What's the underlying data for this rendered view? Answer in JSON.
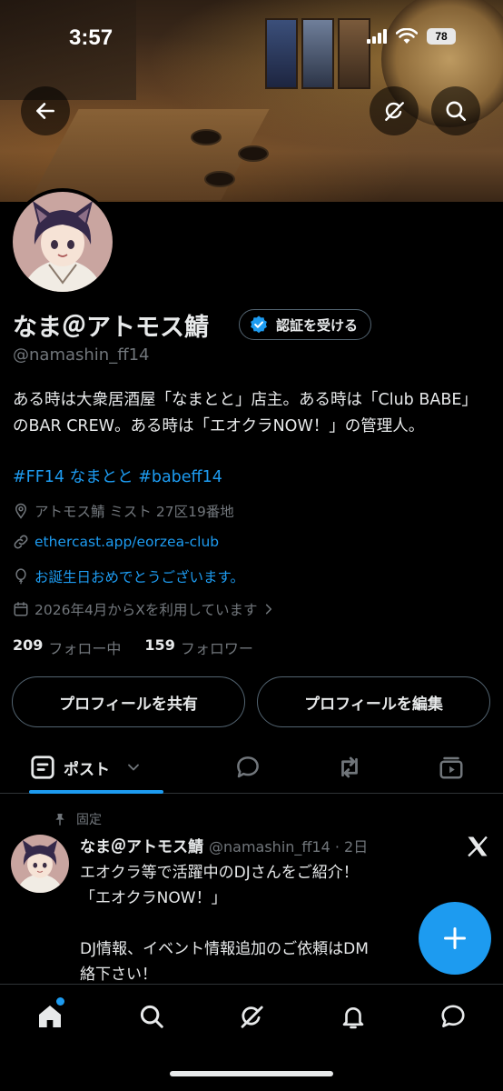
{
  "status_bar": {
    "time": "3:57",
    "battery": "78"
  },
  "header": {
    "icons": {
      "back": "arrow-left-icon",
      "grok": "grok-icon",
      "search": "search-icon"
    }
  },
  "profile": {
    "name": "なま＠アトモス鯖",
    "verify_label": "認証を受ける",
    "handle": "@namashin_ff14",
    "bio": "ある時は大衆居酒屋「なまとと」店主。ある時は「Club BABE」のBAR CREW。ある時は「エオクラNOW！」の管理人。",
    "hashtags": "#FF14 なまとと #babeff14",
    "location": "アトモス鯖 ミスト 27区19番地",
    "website": "ethercast.app/eorzea-club",
    "birthday": "お誕生日おめでとうございます。",
    "joined": "2026年4月からXを利用しています",
    "following_count": "209",
    "following_label": "フォロー中",
    "followers_count": "159",
    "followers_label": "フォロワー",
    "share_label": "プロフィールを共有",
    "edit_label": "プロフィールを編集"
  },
  "tabs": {
    "posts_label": "ポスト"
  },
  "pinned_post": {
    "pinned_label": "固定",
    "author_name": "なま＠アトモス鯖",
    "author_meta": "@namashin_ff14 · 2日",
    "line1": "エオクラ等で活躍中のDJさんをご紹介！",
    "line2": "「エオクラNOW！」",
    "line3": "",
    "line4": "DJ情報、イベント情報追加のご依頼はDM",
    "line5": "絡下さい！"
  },
  "colors": {
    "accent": "#1d9bf0",
    "background": "#000000",
    "muted": "#71767b",
    "text": "#e7e9ea"
  }
}
